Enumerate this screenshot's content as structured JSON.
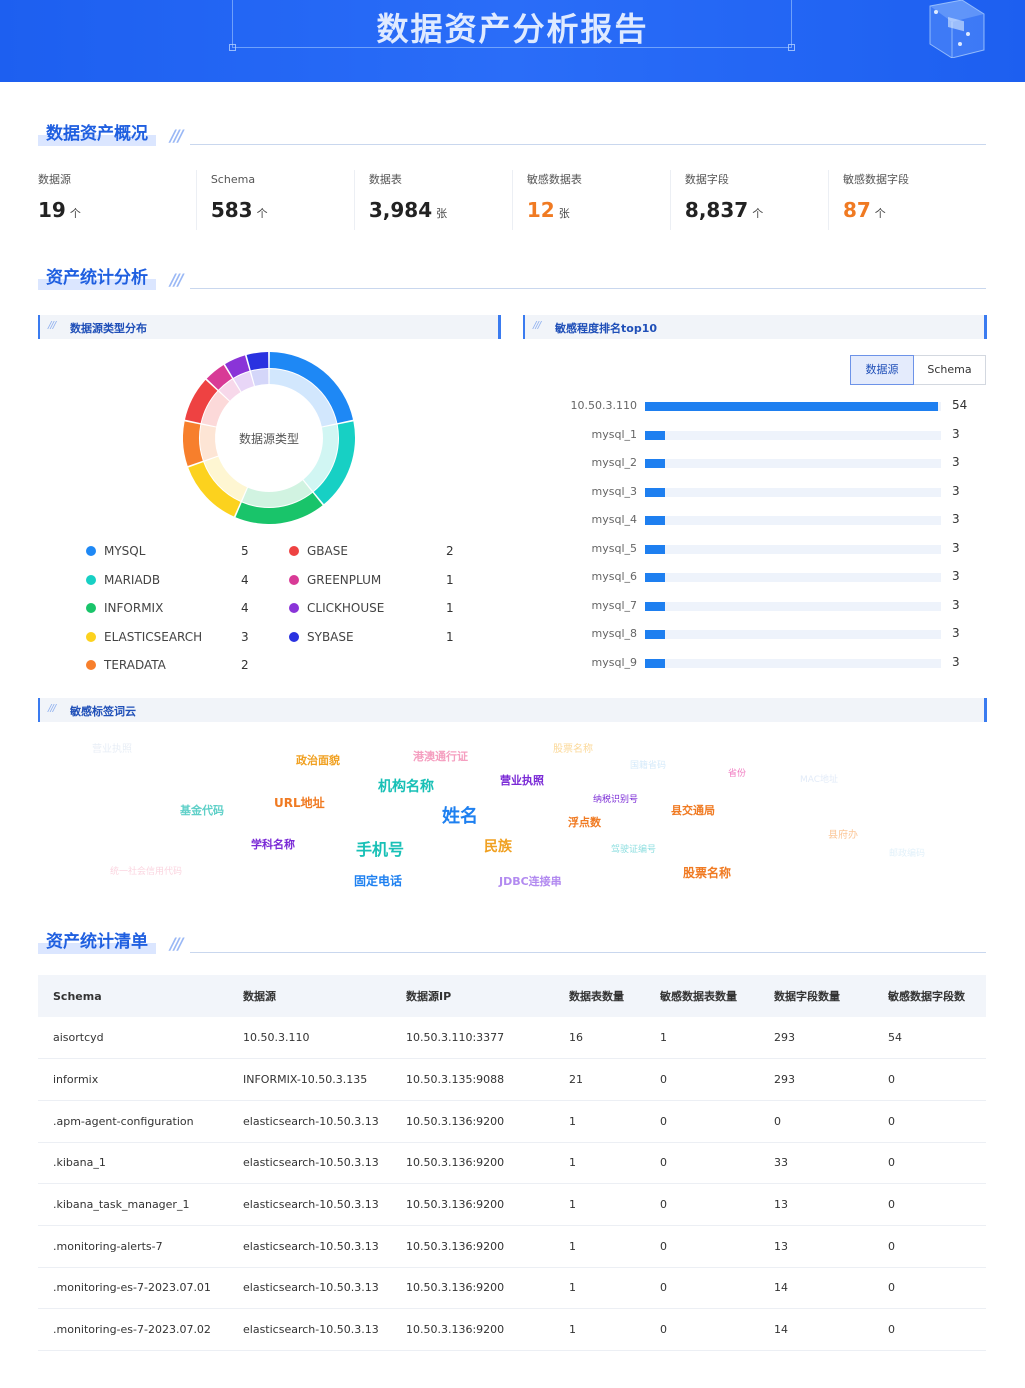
{
  "header": {
    "title": "数据资产分析报告",
    "badge_icon": "report-cube-icon"
  },
  "sections": {
    "overview": "数据资产概况",
    "analysis": "资产统计分析",
    "list": "资产统计清单"
  },
  "stats": [
    {
      "label": "数据源",
      "value": "19",
      "unit": "个",
      "color": "#222222"
    },
    {
      "label": "Schema",
      "value": "583",
      "unit": "个",
      "color": "#222222"
    },
    {
      "label": "数据表",
      "value": "3,984",
      "unit": "张",
      "color": "#222222"
    },
    {
      "label": "敏感数据表",
      "value": "12",
      "unit": "张",
      "color": "#f07a22"
    },
    {
      "label": "数据字段",
      "value": "8,837",
      "unit": "个",
      "color": "#222222"
    },
    {
      "label": "敏感数据字段",
      "value": "87",
      "unit": "个",
      "color": "#f07a22"
    }
  ],
  "panels": {
    "type_dist": "数据源类型分布",
    "sensitive_rank": "敏感程度排名top10",
    "word_cloud": "敏感标签词云"
  },
  "donut": {
    "center_label": "数据源类型",
    "items": [
      {
        "name": "MYSQL",
        "count": 5,
        "color": "#1e88f5"
      },
      {
        "name": "MARIADB",
        "count": 4,
        "color": "#17d0c4"
      },
      {
        "name": "INFORMIX",
        "count": 4,
        "color": "#19c46a"
      },
      {
        "name": "ELASTICSEARCH",
        "count": 3,
        "color": "#fcd21e"
      },
      {
        "name": "TERADATA",
        "count": 2,
        "color": "#f77f2c"
      },
      {
        "name": "GBASE",
        "count": 2,
        "color": "#ee4242"
      },
      {
        "name": "GREENPLUM",
        "count": 1,
        "color": "#d83a96"
      },
      {
        "name": "CLICKHOUSE",
        "count": 1,
        "color": "#8a34d8"
      },
      {
        "name": "SYBASE",
        "count": 1,
        "color": "#2a32e0"
      }
    ]
  },
  "rank_toggle": {
    "options": [
      "数据源",
      "Schema"
    ],
    "active": 0
  },
  "chart_data": {
    "type": "bar",
    "orientation": "horizontal",
    "categories": [
      "10.50.3.110",
      "mysql_1",
      "mysql_2",
      "mysql_3",
      "mysql_4",
      "mysql_5",
      "mysql_6",
      "mysql_7",
      "mysql_8",
      "mysql_9"
    ],
    "values": [
      54,
      3,
      3,
      3,
      3,
      3,
      3,
      3,
      3,
      3
    ],
    "xlim": [
      0,
      54
    ],
    "color": "#1e7ff0",
    "track_color": "#eef3fb"
  },
  "word_cloud": [
    {
      "text": "营业执照",
      "color": "#e8eef6",
      "size": 10
    },
    {
      "text": "政治面貌",
      "color": "#f0a020",
      "size": 11
    },
    {
      "text": "港澳通行证",
      "color": "#f59fc0",
      "size": 11
    },
    {
      "text": "股票名称",
      "color": "#fbd99a",
      "size": 10
    },
    {
      "text": "国籍省码",
      "color": "#d5eafa",
      "size": 9
    },
    {
      "text": "省份",
      "color": "#f07ac0",
      "size": 9
    },
    {
      "text": "MAC地址",
      "color": "#e2ebf8",
      "size": 9
    },
    {
      "text": "机构名称",
      "color": "#18c0b6",
      "size": 14
    },
    {
      "text": "营业执照",
      "color": "#7a2ad6",
      "size": 11
    },
    {
      "text": "基金代码",
      "color": "#5fd0c8",
      "size": 11
    },
    {
      "text": "URL地址",
      "color": "#f07a22",
      "size": 12
    },
    {
      "text": "姓名",
      "color": "#1e80f0",
      "size": 18
    },
    {
      "text": "纳税识别号",
      "color": "#7a2ad6",
      "size": 9
    },
    {
      "text": "浮点数",
      "color": "#f07a22",
      "size": 11
    },
    {
      "text": "县交通局",
      "color": "#f07a22",
      "size": 11
    },
    {
      "text": "县府办",
      "color": "#fbc79a",
      "size": 10
    },
    {
      "text": "学科名称",
      "color": "#7a2ad6",
      "size": 11
    },
    {
      "text": "手机号",
      "color": "#18c0b6",
      "size": 16
    },
    {
      "text": "民族",
      "color": "#f0a020",
      "size": 14
    },
    {
      "text": "驾驶证编号",
      "color": "#8fdfe0",
      "size": 9
    },
    {
      "text": "邮政编码",
      "color": "#e2f1fa",
      "size": 9
    },
    {
      "text": "统一社会信用代码",
      "color": "#fbd5e0",
      "size": 9
    },
    {
      "text": "固定电话",
      "color": "#1e80f0",
      "size": 12
    },
    {
      "text": "JDBC连接串",
      "color": "#b28af0",
      "size": 11
    },
    {
      "text": "股票名称",
      "color": "#f07a22",
      "size": 12
    }
  ],
  "table": {
    "columns": [
      "Schema",
      "数据源",
      "数据源IP",
      "数据表数量",
      "敏感数据表数量",
      "数据字段数量",
      "敏感数据字段数"
    ],
    "rows": [
      [
        "aisortcyd",
        "10.50.3.110",
        "10.50.3.110:3377",
        "16",
        "1",
        "293",
        "54"
      ],
      [
        "informix",
        "INFORMIX-10.50.3.135",
        "10.50.3.135:9088",
        "21",
        "0",
        "293",
        "0"
      ],
      [
        ".apm-agent-configuration",
        "elasticsearch-10.50.3.13",
        "10.50.3.136:9200",
        "1",
        "0",
        "0",
        "0"
      ],
      [
        ".kibana_1",
        "elasticsearch-10.50.3.13",
        "10.50.3.136:9200",
        "1",
        "0",
        "33",
        "0"
      ],
      [
        ".kibana_task_manager_1",
        "elasticsearch-10.50.3.13",
        "10.50.3.136:9200",
        "1",
        "0",
        "13",
        "0"
      ],
      [
        ".monitoring-alerts-7",
        "elasticsearch-10.50.3.13",
        "10.50.3.136:9200",
        "1",
        "0",
        "13",
        "0"
      ],
      [
        ".monitoring-es-7-2023.07.01",
        "elasticsearch-10.50.3.13",
        "10.50.3.136:9200",
        "1",
        "0",
        "14",
        "0"
      ],
      [
        ".monitoring-es-7-2023.07.02",
        "elasticsearch-10.50.3.13",
        "10.50.3.136:9200",
        "1",
        "0",
        "14",
        "0"
      ]
    ]
  }
}
